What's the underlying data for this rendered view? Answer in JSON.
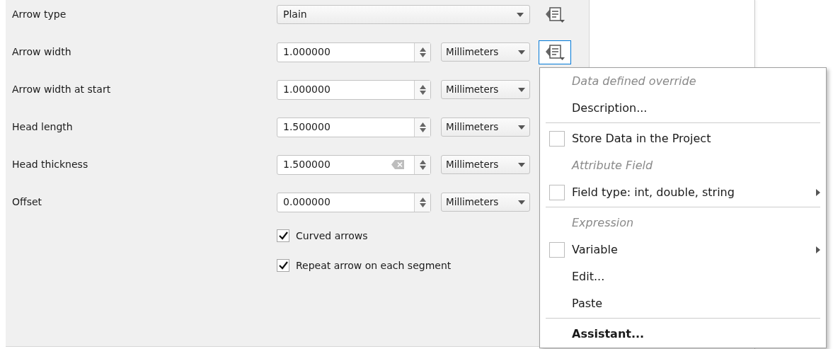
{
  "rows": [
    {
      "kind": "combo",
      "label": "Arrow type",
      "value": "Plain",
      "override_button": {
        "focused": false
      }
    },
    {
      "kind": "spin",
      "label": "Arrow width",
      "value": "1.000000",
      "clearable": false,
      "unit": "Millimeters",
      "override_button": {
        "focused": true
      }
    },
    {
      "kind": "spin",
      "label": "Arrow width at start",
      "value": "1.000000",
      "clearable": false,
      "unit": "Millimeters"
    },
    {
      "kind": "spin",
      "label": "Head length",
      "value": "1.500000",
      "clearable": false,
      "unit": "Millimeters"
    },
    {
      "kind": "spin",
      "label": "Head thickness",
      "value": "1.500000",
      "clearable": true,
      "unit": "Millimeters"
    },
    {
      "kind": "spin",
      "label": "Offset",
      "value": "0.000000",
      "clearable": false,
      "unit": "Millimeters"
    }
  ],
  "options": [
    {
      "label": "Curved arrows",
      "checked": true
    },
    {
      "label": "Repeat arrow on each segment",
      "checked": true
    }
  ],
  "menu": [
    {
      "kind": "header",
      "label": "Data defined override"
    },
    {
      "kind": "action",
      "label": "Description..."
    },
    {
      "kind": "separator"
    },
    {
      "kind": "check",
      "label": "Store Data in the Project",
      "checked": false,
      "submenu": false
    },
    {
      "kind": "header",
      "label": "Attribute Field"
    },
    {
      "kind": "check",
      "label": "Field type: int, double, string",
      "checked": false,
      "submenu": true
    },
    {
      "kind": "separator"
    },
    {
      "kind": "header",
      "label": "Expression"
    },
    {
      "kind": "check",
      "label": "Variable",
      "checked": false,
      "submenu": true
    },
    {
      "kind": "action",
      "label": "Edit..."
    },
    {
      "kind": "action",
      "label": "Paste"
    },
    {
      "kind": "separator"
    },
    {
      "kind": "strong",
      "label": "Assistant..."
    }
  ]
}
